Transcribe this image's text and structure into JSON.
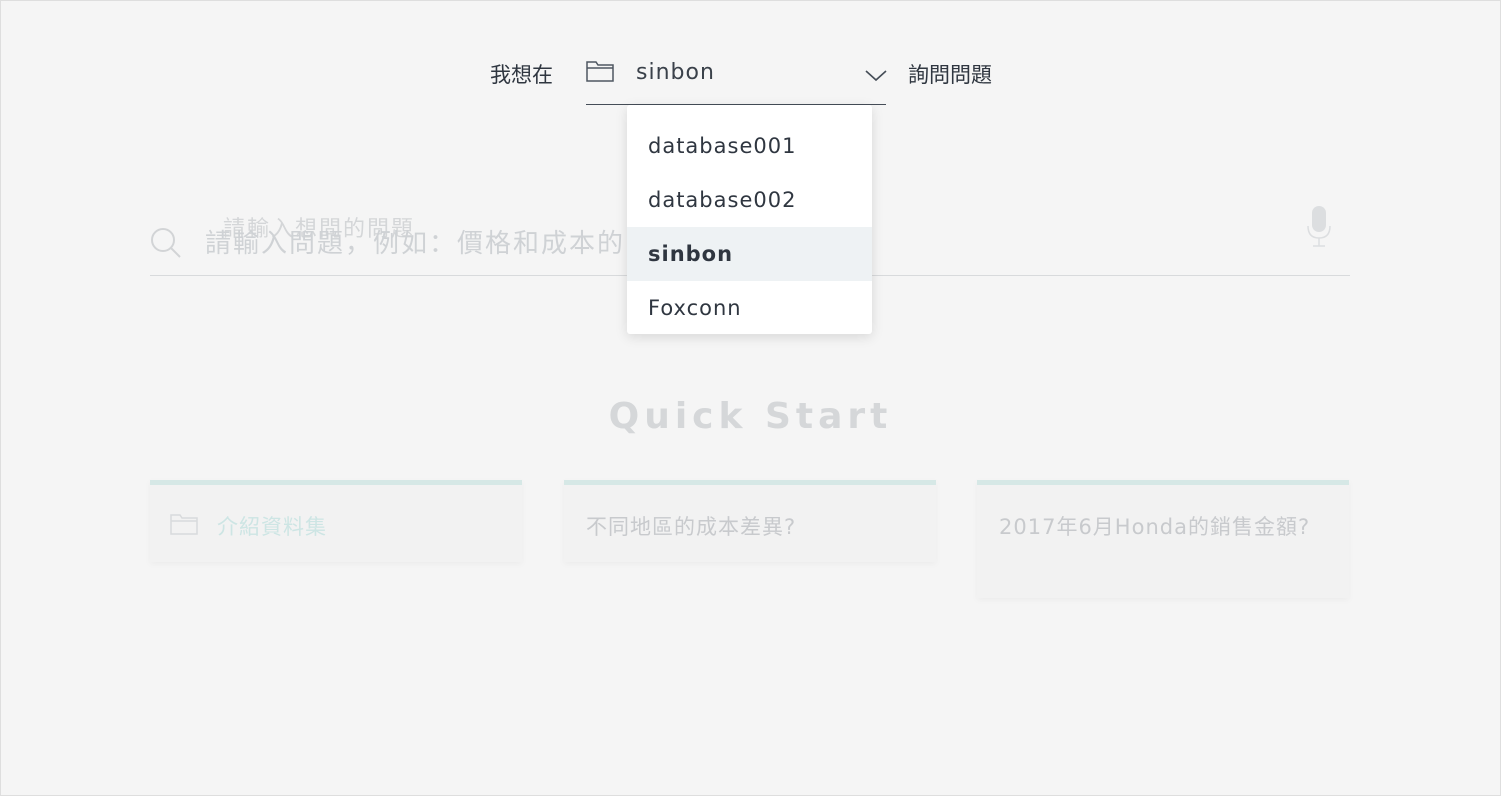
{
  "selector": {
    "prefix": "我想在",
    "selected": "sinbon",
    "suffix": "詢問問題",
    "options": [
      "database001",
      "database002",
      "sinbon",
      "Foxconn"
    ]
  },
  "search": {
    "ghost_label": "請輸入想問的問題",
    "placeholder": "請輸入問題，例如：價格和成本的關係"
  },
  "quick_start": {
    "title": "Quick Start",
    "cards": [
      {
        "label": "介紹資料集",
        "icon": "folder-icon"
      },
      {
        "label": "不同地區的成本差異?"
      },
      {
        "label": "2017年6月Honda的銷售金額?"
      }
    ]
  },
  "colors": {
    "background": "#f5f5f5",
    "accent": "#d6e8e6",
    "text": "#2f3640",
    "selected_option_bg": "#eef2f4"
  }
}
